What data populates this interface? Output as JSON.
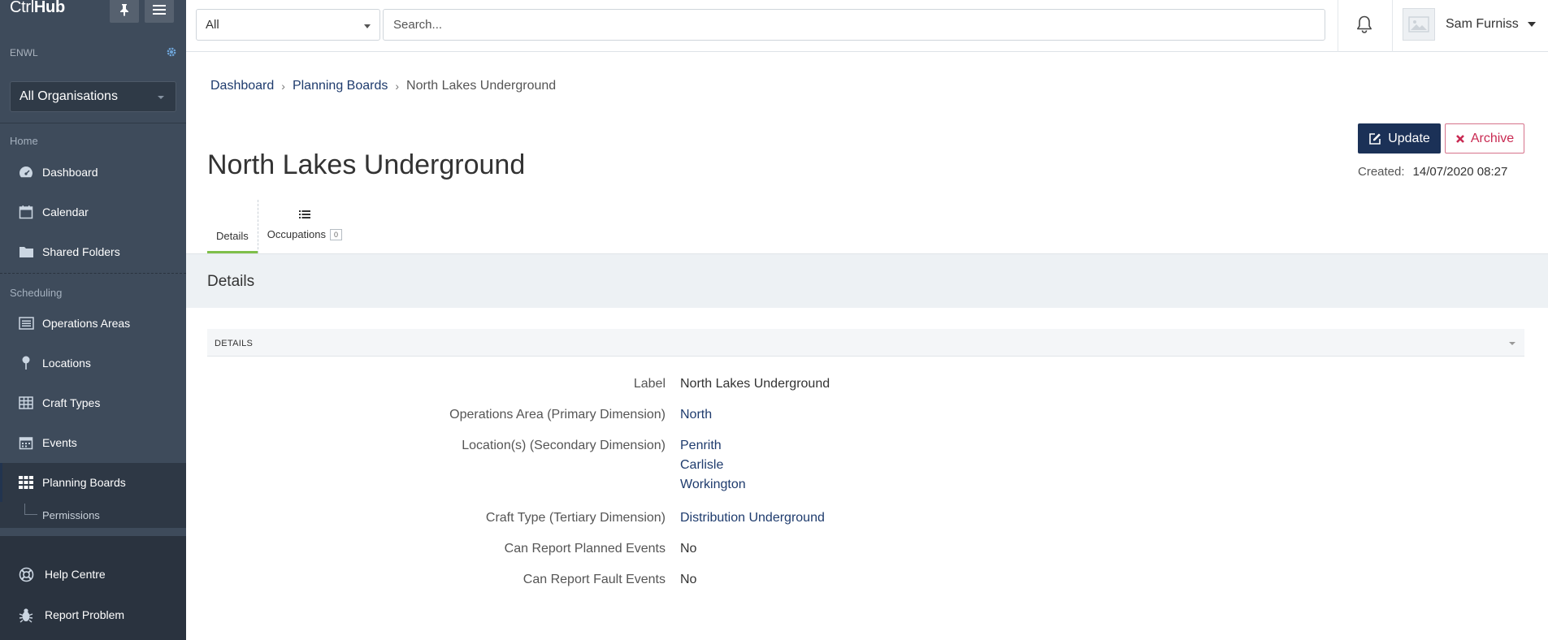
{
  "brand": {
    "prefix": "Ctrl",
    "bold": "Hub"
  },
  "sidebar": {
    "org_code": "ENWL",
    "org_select": "All Organisations",
    "sections": [
      {
        "label": "Home"
      },
      {
        "label": "Scheduling"
      }
    ],
    "home_items": [
      {
        "label": "Dashboard",
        "icon": "dashboard-icon"
      },
      {
        "label": "Calendar",
        "icon": "calendar-icon"
      },
      {
        "label": "Shared Folders",
        "icon": "folder-icon"
      }
    ],
    "scheduling_items": [
      {
        "label": "Operations Areas",
        "icon": "list-icon"
      },
      {
        "label": "Locations",
        "icon": "pin-icon"
      },
      {
        "label": "Craft Types",
        "icon": "table-icon"
      },
      {
        "label": "Events",
        "icon": "calendar-icon"
      },
      {
        "label": "Planning Boards",
        "icon": "grid-icon"
      }
    ],
    "sub_items": [
      {
        "label": "Permissions"
      }
    ],
    "bottom_items": [
      {
        "label": "Help Centre",
        "icon": "lifebuoy-icon"
      },
      {
        "label": "Report Problem",
        "icon": "bug-icon"
      }
    ]
  },
  "topbar": {
    "filter_value": "All",
    "search_placeholder": "Search...",
    "user_name": "Sam Furniss"
  },
  "breadcrumb": [
    "Dashboard",
    "Planning Boards",
    "North Lakes Underground"
  ],
  "page": {
    "title": "North Lakes Underground",
    "update_label": "Update",
    "archive_label": "Archive",
    "created_label": "Created:",
    "created_value": "14/07/2020 08:27"
  },
  "tabs": [
    {
      "label": "Details"
    },
    {
      "label": "Occupations",
      "count": "0"
    }
  ],
  "details": {
    "band_title": "Details",
    "panel_title": "DETAILS",
    "fields": [
      {
        "label": "Label",
        "value": "North Lakes Underground"
      },
      {
        "label": "Operations Area (Primary Dimension)",
        "value": "North"
      },
      {
        "label": "Location(s) (Secondary Dimension)",
        "values": [
          "Penrith",
          "Carlisle",
          "Workington"
        ]
      },
      {
        "label": "Craft Type (Tertiary Dimension)",
        "value": "Distribution Underground"
      },
      {
        "label": "Can Report Planned Events",
        "value": "No"
      },
      {
        "label": "Can Report Fault Events",
        "value": "No"
      }
    ]
  },
  "colors": {
    "sidebar_bg": "#3e4b5b",
    "primary": "#1b3157",
    "danger": "#c92a52",
    "tab_active": "#7fbf4a",
    "link": "#1e3b6d"
  }
}
